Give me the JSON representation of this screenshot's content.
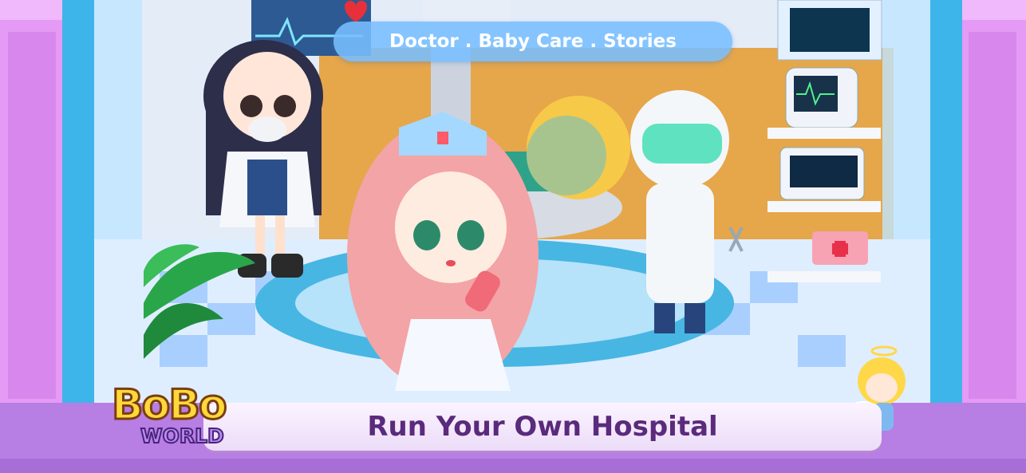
{
  "banner": {
    "top_text": "Doctor . Baby Care . Stories",
    "bottom_text": "Run Your Own Hospital"
  },
  "logo": {
    "line1": "BoBo",
    "line2": "WORLD"
  },
  "colors": {
    "frame": "#d884ee",
    "pillar": "#3fb6e8",
    "floor_blue": "#9fd0ff",
    "pill": "#78beff",
    "banner_text": "#5a2a7c"
  },
  "icons": [
    "heart-icon",
    "monitor-icon",
    "first-aid-kit-icon",
    "scissors-icon",
    "plant-icon",
    "angel-icon"
  ]
}
